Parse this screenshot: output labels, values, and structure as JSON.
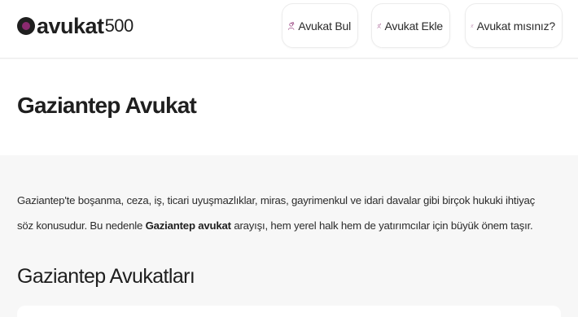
{
  "header": {
    "logo_word": "avukat",
    "logo_number": "500",
    "nav": [
      {
        "label": "Avukat Bul",
        "icon": "user-search-icon"
      },
      {
        "label": "Avukat Ekle",
        "icon": "user-add-icon"
      },
      {
        "label": "Avukat mısınız?",
        "icon": "user-question-icon"
      }
    ]
  },
  "colors": {
    "accent": "#8a2a6f",
    "text": "#1f1f1f",
    "page_bg": "#f7f7f7"
  },
  "main": {
    "title": "Gaziantep Avukat",
    "intro_part1": "Gaziantep'te boşanma, ceza, iş, ticari uyuşmazlıklar, miras, gayrimenkul ve idari davalar gibi birçok hukuki ihtiyaç söz konusudur. Bu nedenle ",
    "intro_bold": "Gaziantep avukat",
    "intro_part2": " arayışı, hem yerel halk hem de yatırımcılar için büyük önem taşır.",
    "section_title": "Gaziantep Avukatları"
  }
}
